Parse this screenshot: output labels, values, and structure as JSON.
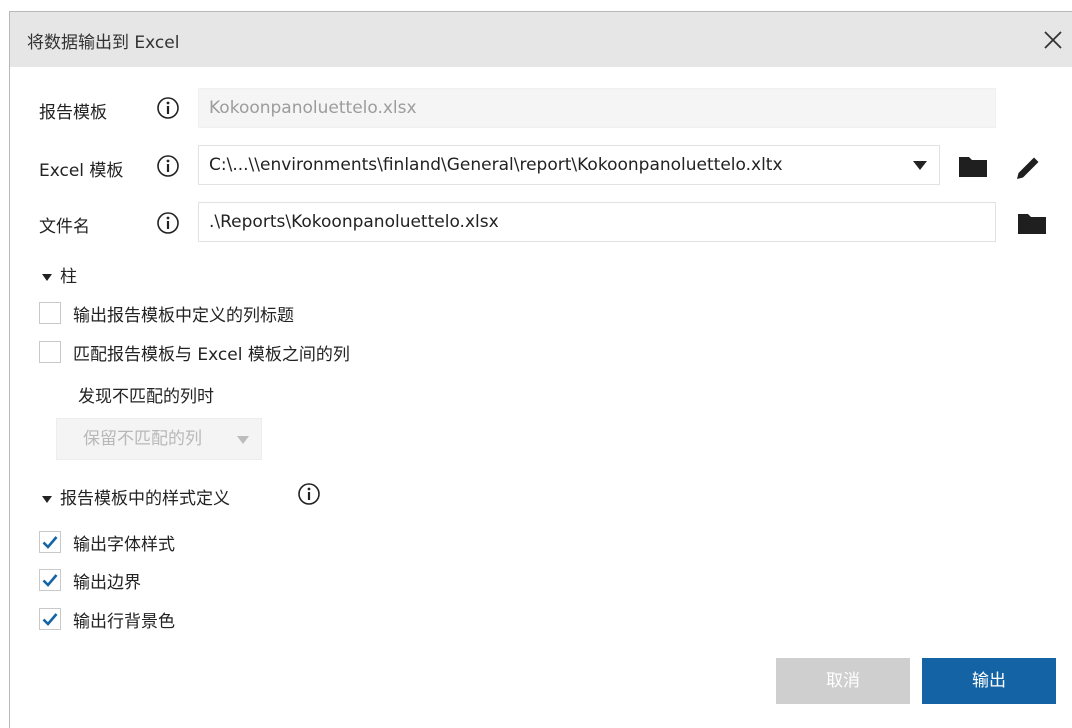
{
  "dialog": {
    "title": "将数据输出到 Excel",
    "close_glyph": "✕"
  },
  "report_template": {
    "label": "报告模板",
    "value": "Kokoonpanoluettelo.xlsx"
  },
  "excel_template": {
    "label": "Excel 模板",
    "value": "C:\\...\\\\environments\\finland\\General\\report\\Kokoonpanoluettelo.xltx"
  },
  "file_name": {
    "label": "文件名",
    "value": ".\\Reports\\Kokoonpanoluettelo.xlsx"
  },
  "columns_section": {
    "title": "柱",
    "output_headers": {
      "label": "输出报告模板中定义的列标题",
      "checked": false
    },
    "match_columns": {
      "label": "匹配报告模板与 Excel 模板之间的列",
      "checked": false
    },
    "mismatch_label": "发现不匹配的列时",
    "mismatch_select": "保留不匹配的列"
  },
  "styles_section": {
    "title": "报告模板中的样式定义",
    "font_styles": {
      "label": "输出字体样式",
      "checked": true
    },
    "borders": {
      "label": "输出边界",
      "checked": true
    },
    "row_background": {
      "label": "输出行背景色",
      "checked": true
    }
  },
  "buttons": {
    "cancel": "取消",
    "export": "输出"
  },
  "colors": {
    "accent": "#1464a5",
    "check": "#1464a5",
    "titlebar": "#e6e6e6"
  },
  "icons": [
    "info-icon",
    "dropdown-arrow-icon",
    "folder-icon",
    "pencil-icon",
    "close-icon",
    "checkmark-icon"
  ]
}
